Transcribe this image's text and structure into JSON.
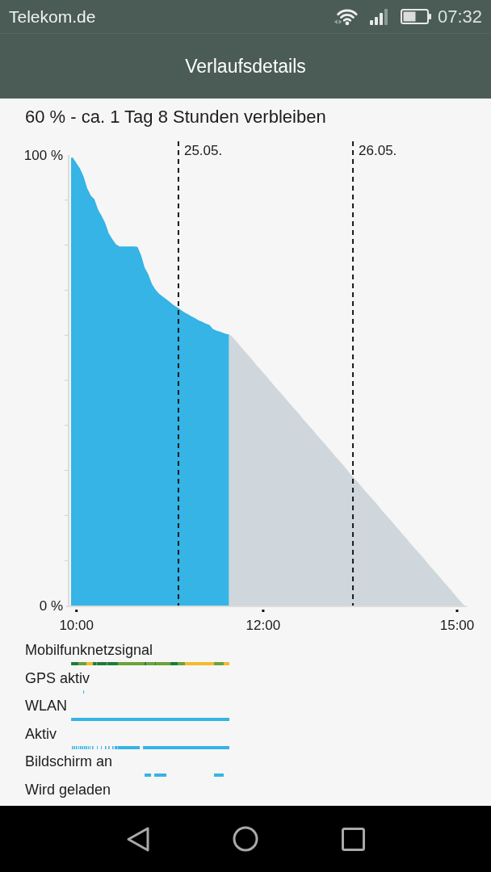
{
  "status_bar": {
    "carrier": "Telekom.de",
    "time": "07:32"
  },
  "title_bar": {
    "title": "Verlaufsdetails"
  },
  "summary": "60 % - ca. 1 Tag 8 Stunden verbleiben",
  "chart": {
    "chart_data": {
      "type": "area",
      "categories": [
        null,
        "10:00",
        null,
        null,
        null,
        null,
        null,
        null,
        null,
        null,
        null,
        null,
        null,
        null,
        null,
        null,
        null,
        null,
        null,
        null,
        null,
        null,
        null,
        null,
        null,
        null,
        null,
        null,
        null,
        null,
        null,
        null,
        null,
        null,
        null,
        null,
        null,
        null,
        null,
        null,
        null,
        null,
        null,
        null,
        null,
        null,
        null,
        null,
        null,
        null,
        null,
        null,
        null,
        "12:00",
        null,
        null,
        null,
        null,
        null,
        null,
        null,
        null,
        null,
        null,
        null,
        null,
        null,
        null,
        null,
        null,
        null,
        null,
        null,
        null,
        null,
        null,
        null,
        null,
        null,
        null,
        null,
        null,
        null,
        null,
        null,
        null,
        null,
        null,
        null,
        null,
        null,
        null,
        null,
        null,
        null,
        null,
        null,
        null,
        null,
        null,
        null,
        null,
        null,
        null,
        null,
        null,
        null,
        "15:00",
        null,
        null
      ],
      "series": [
        {
          "color": "#35b4e5",
          "values": [
            99.4,
            98.2,
            97.0,
            95.2,
            92.6,
            91.0,
            90.2,
            87.9,
            86.5,
            84.9,
            82.6,
            81.3,
            80.2,
            79.7,
            79.7,
            79.7,
            79.7,
            79.7,
            79.6,
            77.8,
            75.0,
            73.5,
            71.4,
            70.1,
            69.2,
            68.6,
            68.0,
            67.4,
            66.7,
            66.2,
            65.7,
            65.1,
            64.7,
            64.2,
            63.8,
            63.3,
            63.0,
            62.6,
            62.3,
            61.4,
            61.0,
            60.8,
            60.5,
            60.2,
            null,
            null,
            null,
            null,
            null,
            null,
            null,
            null,
            null,
            null,
            null,
            null,
            null,
            null,
            null,
            null,
            null,
            null,
            null,
            null,
            null,
            null,
            null,
            null,
            null,
            null,
            null,
            null,
            null,
            null,
            null,
            null,
            null,
            null,
            null,
            null,
            null,
            null,
            null,
            null,
            null,
            null,
            null,
            null,
            null,
            null,
            null,
            null,
            null,
            null,
            null,
            null,
            null,
            null,
            null,
            null,
            null,
            null,
            null,
            null,
            null,
            null,
            null,
            null,
            null,
            null
          ]
        },
        {
          "color": "#cfd7dc",
          "values": [
            null,
            null,
            null,
            null,
            null,
            null,
            null,
            null,
            null,
            null,
            null,
            null,
            null,
            null,
            null,
            null,
            null,
            null,
            null,
            null,
            null,
            null,
            null,
            null,
            null,
            null,
            null,
            null,
            null,
            null,
            null,
            null,
            null,
            null,
            null,
            null,
            null,
            null,
            null,
            null,
            null,
            null,
            null,
            null,
            60,
            59.1,
            58.2,
            57.2,
            56.3,
            55.4,
            54.5,
            53.5,
            52.6,
            51.7,
            50.8,
            49.8,
            48.9,
            48.0,
            47.1,
            46.2,
            45.2,
            44.3,
            43.4,
            42.5,
            41.5,
            40.6,
            39.7,
            38.8,
            37.8,
            36.9,
            36.0,
            35.1,
            34.2,
            33.2,
            32.3,
            31.4,
            30.5,
            29.5,
            28.6,
            27.7,
            26.8,
            25.8,
            24.9,
            24.0,
            23.1,
            22.2,
            21.2,
            20.3,
            19.4,
            18.5,
            17.5,
            16.6,
            15.7,
            14.8,
            13.8,
            12.9,
            12.0,
            11.1,
            10.2,
            9.2,
            8.3,
            7.4,
            6.5,
            5.5,
            4.6,
            3.7,
            2.8,
            1.8,
            0.9,
            0
          ]
        }
      ],
      "ylim": [
        0,
        100
      ],
      "yticks": [
        {
          "value": 0,
          "label": "0 %"
        },
        {
          "value": 100,
          "label": "100 %"
        }
      ],
      "annotations": [
        "25.05.",
        "26.05."
      ]
    }
  },
  "usage_rows": [
    {
      "label": "Mobilfunknetzsignal",
      "kind": "signal"
    },
    {
      "label": "GPS aktiv",
      "kind": "gps"
    },
    {
      "label": "WLAN",
      "kind": "wlan"
    },
    {
      "label": "Aktiv",
      "kind": "active"
    },
    {
      "label": "Bildschirm an",
      "kind": "screen"
    },
    {
      "label": "Wird geladen",
      "kind": "charging"
    }
  ]
}
